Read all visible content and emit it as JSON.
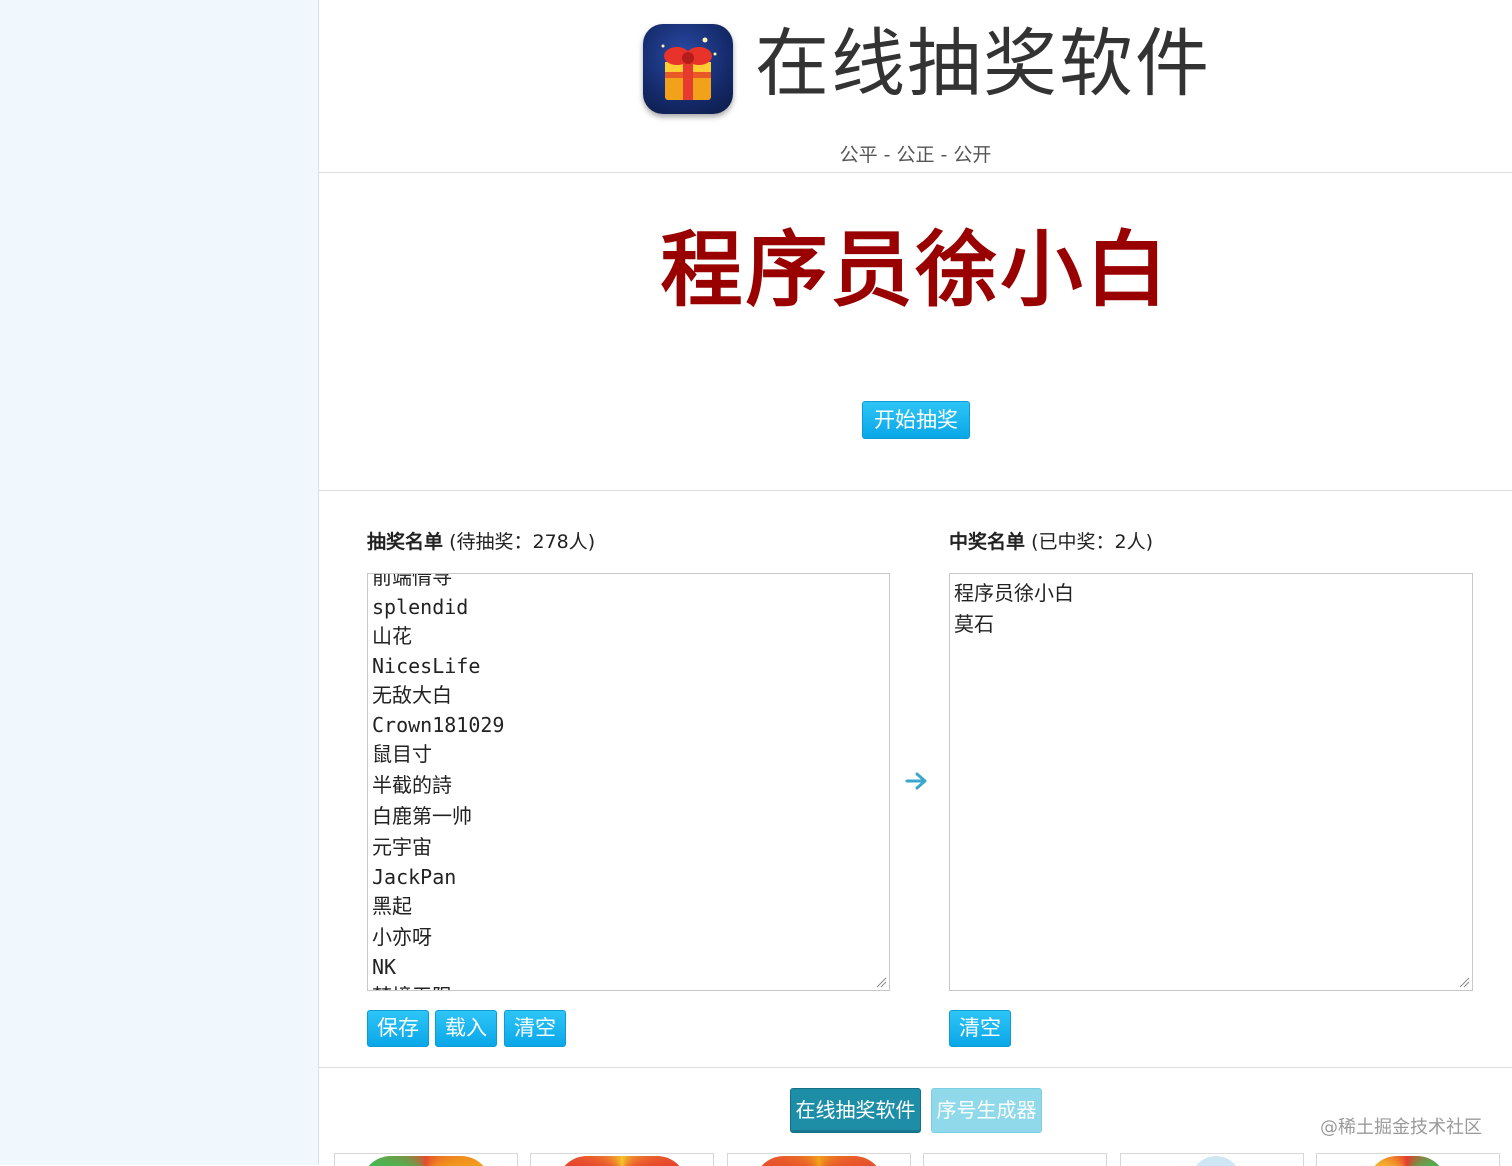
{
  "header": {
    "app_icon": "gift-box-icon",
    "title": "在线抽奖软件",
    "slogan": "公平 - 公正 - 公开"
  },
  "stage": {
    "current_winner": "程序员徐小白",
    "start_button": "开始抽奖"
  },
  "pool": {
    "label_bold": "抽奖名单",
    "label_count": "(待抽奖：278人)",
    "entries": [
      "前端情寻",
      "splendid",
      "山花",
      "NicesLife",
      "无敌大白",
      "Crown181029",
      "鼠目寸",
      "半截的詩",
      "白鹿第一帅",
      "元宇宙",
      "JackPan",
      "黑起",
      "小亦呀",
      "NK",
      "梦境无限"
    ],
    "buttons": {
      "save": "保存",
      "load": "载入",
      "clear": "清空"
    }
  },
  "winners": {
    "label_bold": "中奖名单",
    "label_count": "(已中奖：2人)",
    "entries": [
      "程序员徐小白",
      "莫石"
    ],
    "buttons": {
      "clear": "清空"
    }
  },
  "transfer_icon": "arrow-right-icon",
  "nav": {
    "active": "在线抽奖软件",
    "inactive": "序号生成器"
  },
  "watermark": "@稀土掘金技术社区",
  "colors": {
    "accent": "#0aa7e8",
    "winner_text": "#990000",
    "nav_active": "#1e8ea6",
    "nav_inactive": "#8fd9ea"
  }
}
